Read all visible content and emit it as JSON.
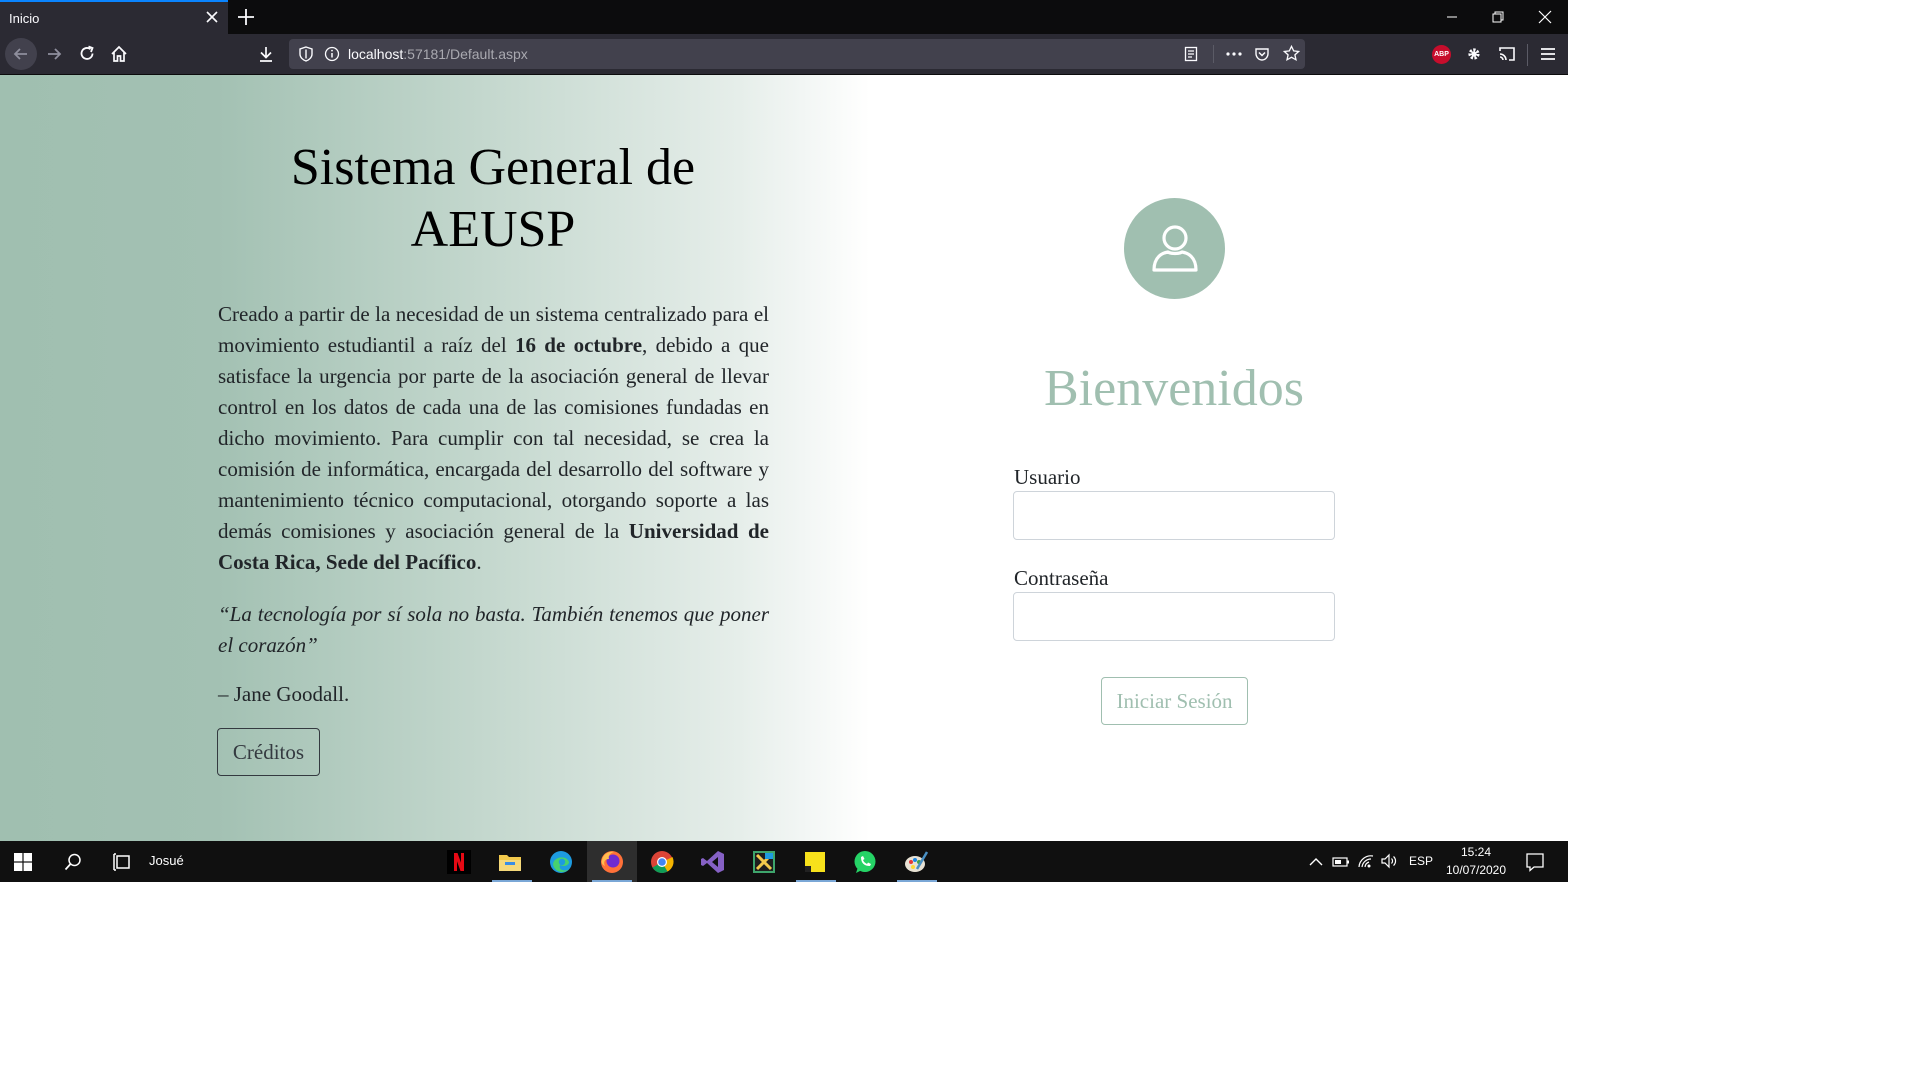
{
  "browser": {
    "tab_title": "Inicio",
    "url_host": "localhost",
    "url_path": ":57181/Default.aspx",
    "extension_badge": "ABP"
  },
  "page": {
    "title": "Sistema General de AEUSP",
    "description": {
      "part1": "Creado a partir de la necesidad de un sistema centralizado para el movimiento estudiantil a raíz del ",
      "bold1": "16 de octubre",
      "part2": ", debido a que satisface la urgencia por parte de la asociación general de llevar control en los datos de cada una de las comisiones fundadas en dicho movimiento. Para cumplir con tal necesidad, se crea la comisión de informática, encargada del desarrollo del software y mantenimiento técnico computacional, otorgando soporte a las demás comisiones y asociación general de la ",
      "bold2": "Universidad de Costa Rica, Sede del Pacífico",
      "part3": "."
    },
    "quote": "“La tecnología por sí sola no basta. También tenemos que poner el corazón”",
    "author": "– Jane Goodall.",
    "credits_button": "Créditos"
  },
  "login": {
    "welcome": "Bienvenidos",
    "username_label": "Usuario",
    "username_value": "",
    "password_label": "Contraseña",
    "password_value": "",
    "submit_button": "Iniciar Sesión"
  },
  "taskbar": {
    "user": "Josué",
    "language": "ESP",
    "time": "15:24",
    "date": "10/07/2020"
  },
  "colors": {
    "accent": "#a0bfb0",
    "text": "#212529",
    "browser_chrome": "#2b2a33"
  }
}
